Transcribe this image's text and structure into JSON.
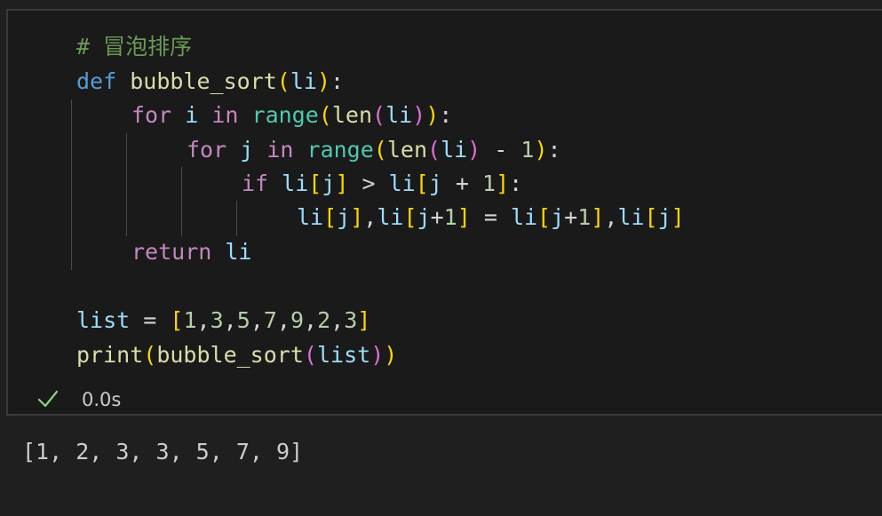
{
  "cell": {
    "code": {
      "comment": "# 冒泡排序",
      "def_kw": "def",
      "func_name": "bubble_sort",
      "param": "li",
      "for_kw": "for",
      "in_kw": "in",
      "range_fn": "range",
      "len_fn": "len",
      "i_var": "i",
      "j_var": "j",
      "one": "1",
      "if_kw": "if",
      "return_kw": "return",
      "list_var": "list",
      "list_values": [
        "1",
        "3",
        "5",
        "7",
        "9",
        "2",
        "3"
      ],
      "print_fn": "print"
    },
    "status": {
      "state": "success",
      "elapsed": "0.0s"
    }
  },
  "output": {
    "text": "[1, 2, 3, 3, 5, 7, 9]"
  },
  "colors": {
    "keyword": "#569cd6",
    "control": "#c586c0",
    "function": "#dcdcaa",
    "builtin": "#4ec9b0",
    "variable": "#9cdcfe",
    "number": "#b5cea8",
    "comment": "#6a9955",
    "bracket_1": "#ffd700",
    "bracket_2": "#da70d6",
    "bracket_3": "#179fff",
    "success": "#89d185"
  }
}
